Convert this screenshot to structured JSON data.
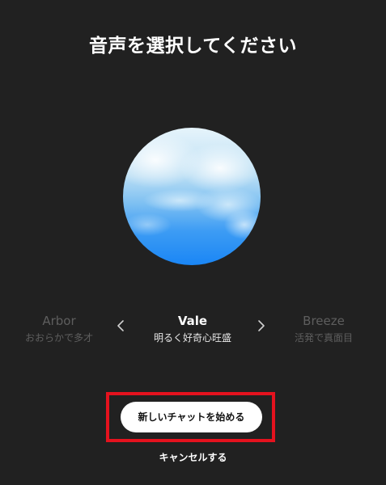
{
  "dialog": {
    "title": "音声を選択してください"
  },
  "voices": {
    "previous": {
      "name": "Arbor",
      "description": "おおらかで多才"
    },
    "selected": {
      "name": "Vale",
      "description": "明るく好奇心旺盛"
    },
    "next": {
      "name": "Breeze",
      "description": "活発で真面目"
    }
  },
  "nav": {
    "prev_icon": "chevron-left-icon",
    "next_icon": "chevron-right-icon"
  },
  "actions": {
    "start_label": "新しいチャットを始める",
    "cancel_label": "キャンセルする"
  },
  "colors": {
    "background": "#212121",
    "highlight": "#e5121e",
    "orb_light": "#dff0fa",
    "orb_deep": "#1a86f5"
  }
}
